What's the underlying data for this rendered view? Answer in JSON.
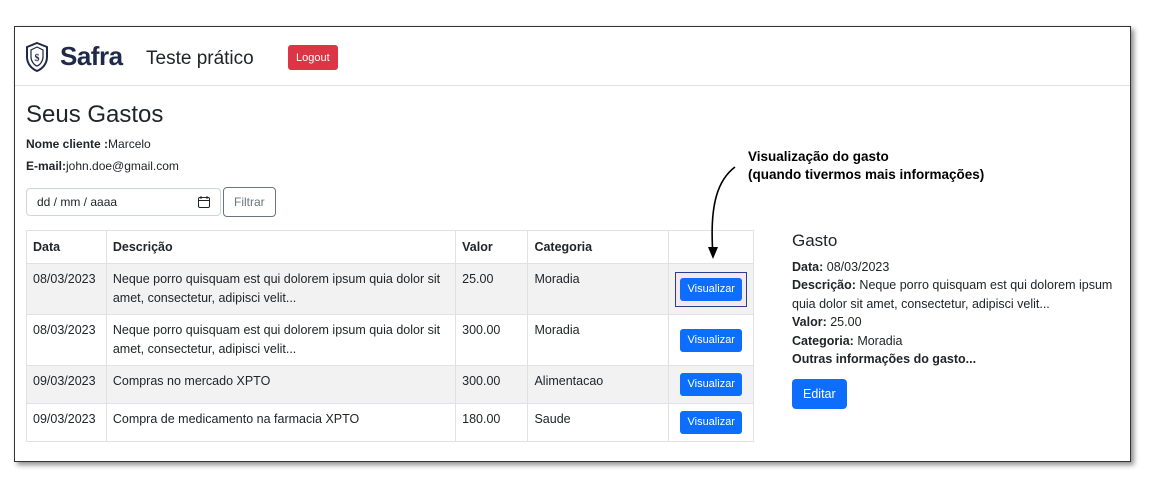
{
  "navbar": {
    "brand": "Safra",
    "title": "Teste prático",
    "logout_label": "Logout"
  },
  "page": {
    "title": "Seus Gastos",
    "client_label": "Nome cliente :",
    "client_value": "Marcelo",
    "email_label": "E-mail:",
    "email_value": "john.doe@gmail.com"
  },
  "filter": {
    "date_placeholder": "dd / mm / aaaa",
    "button_label": "Filtrar"
  },
  "table": {
    "headers": [
      "Data",
      "Descrição",
      "Valor",
      "Categoria",
      ""
    ],
    "rows": [
      {
        "data": "08/03/2023",
        "descricao": "Neque porro quisquam est qui dolorem ipsum quia dolor sit amet, consectetur, adipisci velit...",
        "valor": "25.00",
        "categoria": "Moradia",
        "action": "Visualizar"
      },
      {
        "data": "08/03/2023",
        "descricao": "Neque porro quisquam est qui dolorem ipsum quia dolor sit amet, consectetur, adipisci velit...",
        "valor": "300.00",
        "categoria": "Moradia",
        "action": "Visualizar"
      },
      {
        "data": "09/03/2023",
        "descricao": "Compras no mercado XPTO",
        "valor": "300.00",
        "categoria": "Alimentacao",
        "action": "Visualizar"
      },
      {
        "data": "09/03/2023",
        "descricao": "Compra de medicamento na farmacia XPTO",
        "valor": "180.00",
        "categoria": "Saude",
        "action": "Visualizar"
      }
    ]
  },
  "detail": {
    "title": "Gasto",
    "data_label": "Data:",
    "data_value": "08/03/2023",
    "desc_label": "Descrição:",
    "desc_value": "Neque porro quisquam est qui dolorem ipsum quia dolor sit amet, consectetur, adipisci velit...",
    "valor_label": "Valor:",
    "valor_value": "25.00",
    "categoria_label": "Categoria:",
    "categoria_value": "Moradia",
    "outras": "Outras informações do gasto...",
    "edit_label": "Editar"
  },
  "annotation": {
    "line1": "Visualização do gasto",
    "line2": "(quando tivermos mais informações)"
  },
  "icons": {
    "logo": "safra-shield-logo",
    "calendar": "calendar-icon"
  },
  "colors": {
    "logout": "#dc3545",
    "primary": "#0d6efd",
    "brand": "#1f2a4a"
  }
}
